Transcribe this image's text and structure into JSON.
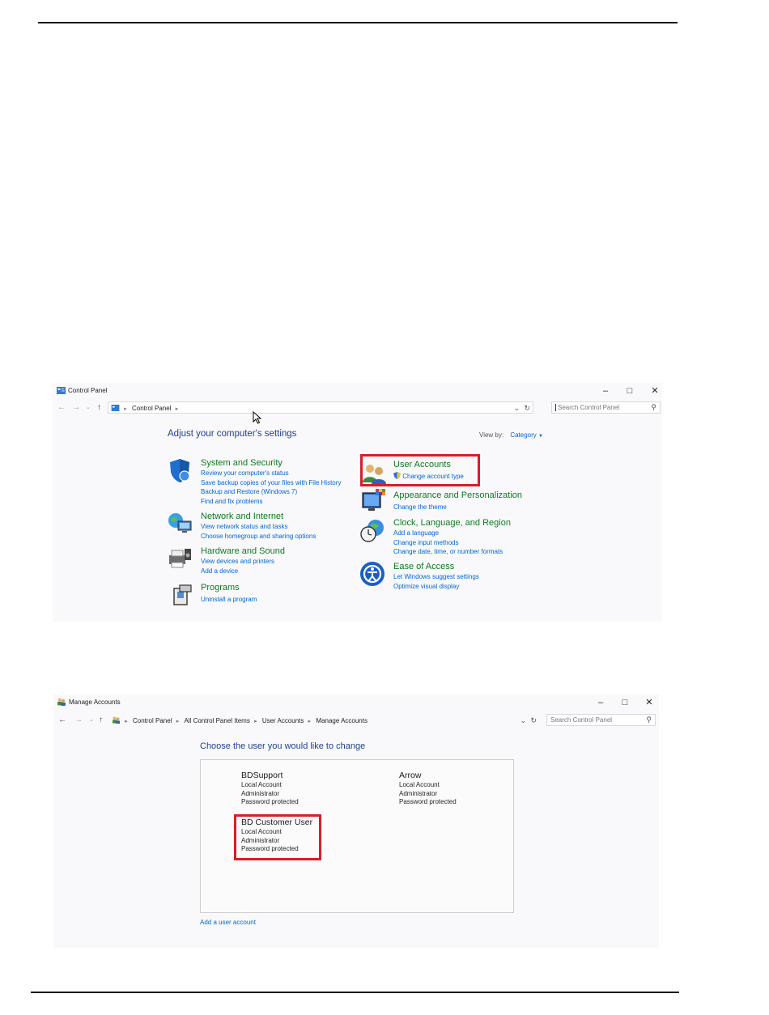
{
  "control_panel": {
    "title": "Control Panel",
    "address_crumbs": [
      "Control Panel"
    ],
    "search_placeholder": "Search Control Panel",
    "heading": "Adjust your computer's settings",
    "view_by_label": "View by:",
    "view_by_value": "Category",
    "categories_left": [
      {
        "title": "System and Security",
        "icon": "shield-icon",
        "links": [
          "Review your computer's status",
          "Save backup copies of your files with File History",
          "Backup and Restore (Windows 7)",
          "Find and fix problems"
        ]
      },
      {
        "title": "Network and Internet",
        "icon": "network-globe-icon",
        "links": [
          "View network status and tasks",
          "Choose homegroup and sharing options"
        ]
      },
      {
        "title": "Hardware and Sound",
        "icon": "printer-speaker-icon",
        "links": [
          "View devices and printers",
          "Add a device"
        ]
      },
      {
        "title": "Programs",
        "icon": "programs-box-icon",
        "links": [
          "Uninstall a program"
        ]
      }
    ],
    "categories_right": [
      {
        "title": "User Accounts",
        "icon": "users-icon",
        "links": [
          "Change account type"
        ]
      },
      {
        "title": "Appearance and Personalization",
        "icon": "monitor-palette-icon",
        "links": [
          "Change the theme"
        ]
      },
      {
        "title": "Clock, Language, and Region",
        "icon": "clock-globe-icon",
        "links": [
          "Add a language",
          "Change input methods",
          "Change date, time, or number formats"
        ]
      },
      {
        "title": "Ease of Access",
        "icon": "ease-of-access-icon",
        "links": [
          "Let Windows suggest settings",
          "Optimize visual display"
        ]
      }
    ]
  },
  "manage_accounts": {
    "title": "Manage Accounts",
    "address_crumbs": [
      "Control Panel",
      "All Control Panel Items",
      "User Accounts",
      "Manage Accounts"
    ],
    "search_placeholder": "Search Control Panel",
    "heading": "Choose the user you would like to change",
    "accounts": [
      {
        "name": "BDSupport",
        "lines": [
          "Local Account",
          "Administrator",
          "Password protected"
        ]
      },
      {
        "name": "Arrow",
        "lines": [
          "Local Account",
          "Administrator",
          "Password protected"
        ]
      },
      {
        "name": "BD Customer User",
        "lines": [
          "Local Account",
          "Administrator",
          "Password protected"
        ]
      }
    ],
    "add_user_link": "Add a user account"
  },
  "colors": {
    "link": "#0066cc",
    "category_heading": "#0d7a1f",
    "highlight": "#d3202a",
    "window_bg": "#f9f9fb"
  }
}
